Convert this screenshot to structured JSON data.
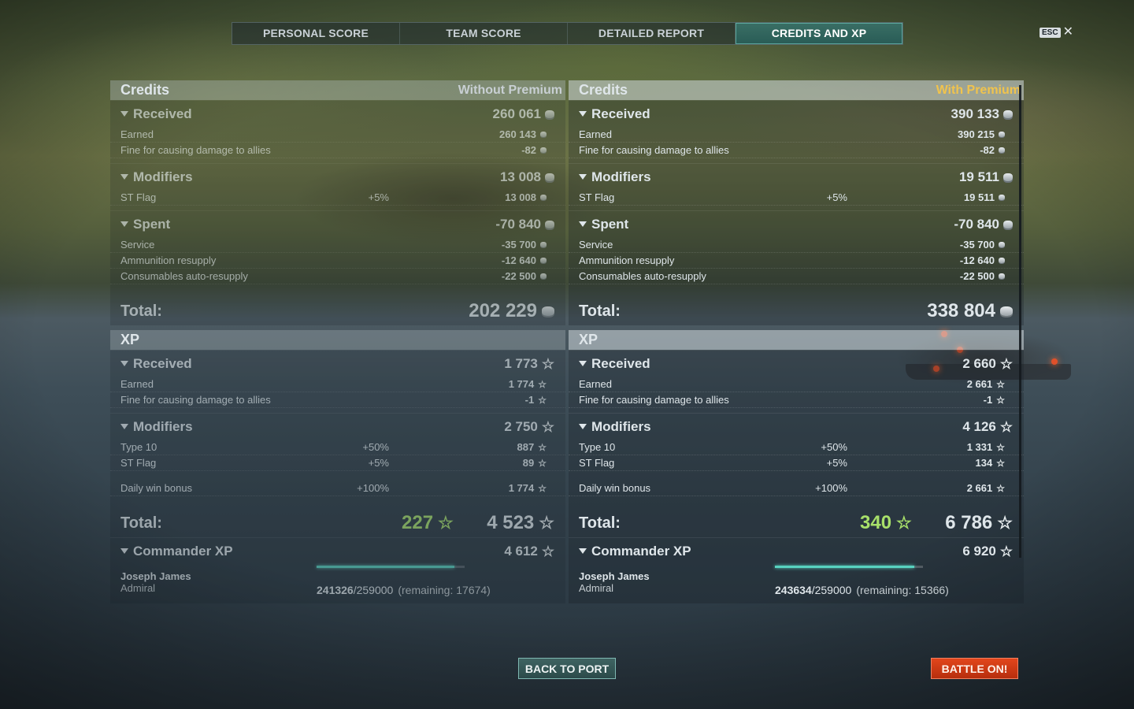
{
  "tabs": [
    "PERSONAL SCORE",
    "TEAM SCORE",
    "DETAILED REPORT",
    "CREDITS AND XP"
  ],
  "active_tab": 3,
  "esc_label": "ESC",
  "close_glyph": "✕",
  "left": {
    "credits_title": "Credits",
    "premium_label": "Without Premium",
    "received": {
      "label": "Received",
      "value": "260 061"
    },
    "earned": {
      "label": "Earned",
      "value": "260 143"
    },
    "fine": {
      "label": "Fine for causing damage to allies",
      "value": "-82"
    },
    "modifiers": {
      "label": "Modifiers",
      "value": "13 008"
    },
    "st_flag": {
      "label": "ST Flag",
      "pct": "+5%",
      "value": "13 008"
    },
    "spent": {
      "label": "Spent",
      "value": "-70 840"
    },
    "service": {
      "label": "Service",
      "value": "-35 700"
    },
    "ammo": {
      "label": "Ammunition resupply",
      "value": "-12 640"
    },
    "consumables": {
      "label": "Consumables auto-resupply",
      "value": "-22 500"
    },
    "total": {
      "label": "Total:",
      "value": "202 229"
    },
    "xp_title": "XP",
    "xp_received": {
      "label": "Received",
      "value": "1 773"
    },
    "xp_earned": {
      "label": "Earned",
      "value": "1 774"
    },
    "xp_fine": {
      "label": "Fine for causing damage to allies",
      "value": "-1"
    },
    "xp_modifiers": {
      "label": "Modifiers",
      "value": "2 750"
    },
    "type10": {
      "label": "Type 10",
      "pct": "+50%",
      "value": "887"
    },
    "xp_st_flag": {
      "label": "ST Flag",
      "pct": "+5%",
      "value": "89"
    },
    "daily": {
      "label": "Daily win bonus",
      "pct": "+100%",
      "value": "1 774"
    },
    "xp_total": {
      "label": "Total:",
      "green": "227",
      "value": "4 523"
    },
    "commander": {
      "label": "Commander XP",
      "value": "4 612"
    },
    "cmdr_name": "Joseph James",
    "cmdr_rank": "Admiral",
    "cmdr_xp": "241326",
    "cmdr_max": "/259000",
    "cmdr_remaining": "(remaining: 17674)",
    "cmdr_progress": 0.932
  },
  "right": {
    "credits_title": "Credits",
    "premium_label": "With Premium",
    "received": {
      "label": "Received",
      "value": "390 133"
    },
    "earned": {
      "label": "Earned",
      "value": "390 215"
    },
    "fine": {
      "label": "Fine for causing damage to allies",
      "value": "-82"
    },
    "modifiers": {
      "label": "Modifiers",
      "value": "19 511"
    },
    "st_flag": {
      "label": "ST Flag",
      "pct": "+5%",
      "value": "19 511"
    },
    "spent": {
      "label": "Spent",
      "value": "-70 840"
    },
    "service": {
      "label": "Service",
      "value": "-35 700"
    },
    "ammo": {
      "label": "Ammunition resupply",
      "value": "-12 640"
    },
    "consumables": {
      "label": "Consumables auto-resupply",
      "value": "-22 500"
    },
    "total": {
      "label": "Total:",
      "value": "338 804"
    },
    "xp_title": "XP",
    "xp_received": {
      "label": "Received",
      "value": "2 660"
    },
    "xp_earned": {
      "label": "Earned",
      "value": "2 661"
    },
    "xp_fine": {
      "label": "Fine for causing damage to allies",
      "value": "-1"
    },
    "xp_modifiers": {
      "label": "Modifiers",
      "value": "4 126"
    },
    "type10": {
      "label": "Type 10",
      "pct": "+50%",
      "value": "1 331"
    },
    "xp_st_flag": {
      "label": "ST Flag",
      "pct": "+5%",
      "value": "134"
    },
    "daily": {
      "label": "Daily win bonus",
      "pct": "+100%",
      "value": "2 661"
    },
    "xp_total": {
      "label": "Total:",
      "green": "340",
      "value": "6 786"
    },
    "commander": {
      "label": "Commander XP",
      "value": "6 920"
    },
    "cmdr_name": "Joseph James",
    "cmdr_rank": "Admiral",
    "cmdr_xp": "243634",
    "cmdr_max": "/259000",
    "cmdr_remaining": "(remaining: 15366)",
    "cmdr_progress": 0.941
  },
  "buttons": {
    "back": "BACK TO PORT",
    "battle": "BATTLE ON!"
  },
  "colors": {
    "accent": "#58d2c0",
    "premium": "#f0c34d",
    "battle": "#d63c16",
    "green_xp": "#a8e06a"
  },
  "icons": {
    "credit": "credit-coin-icon",
    "xp": "xp-star-icon",
    "collapse": "triangle-down-icon",
    "close": "close-icon"
  }
}
